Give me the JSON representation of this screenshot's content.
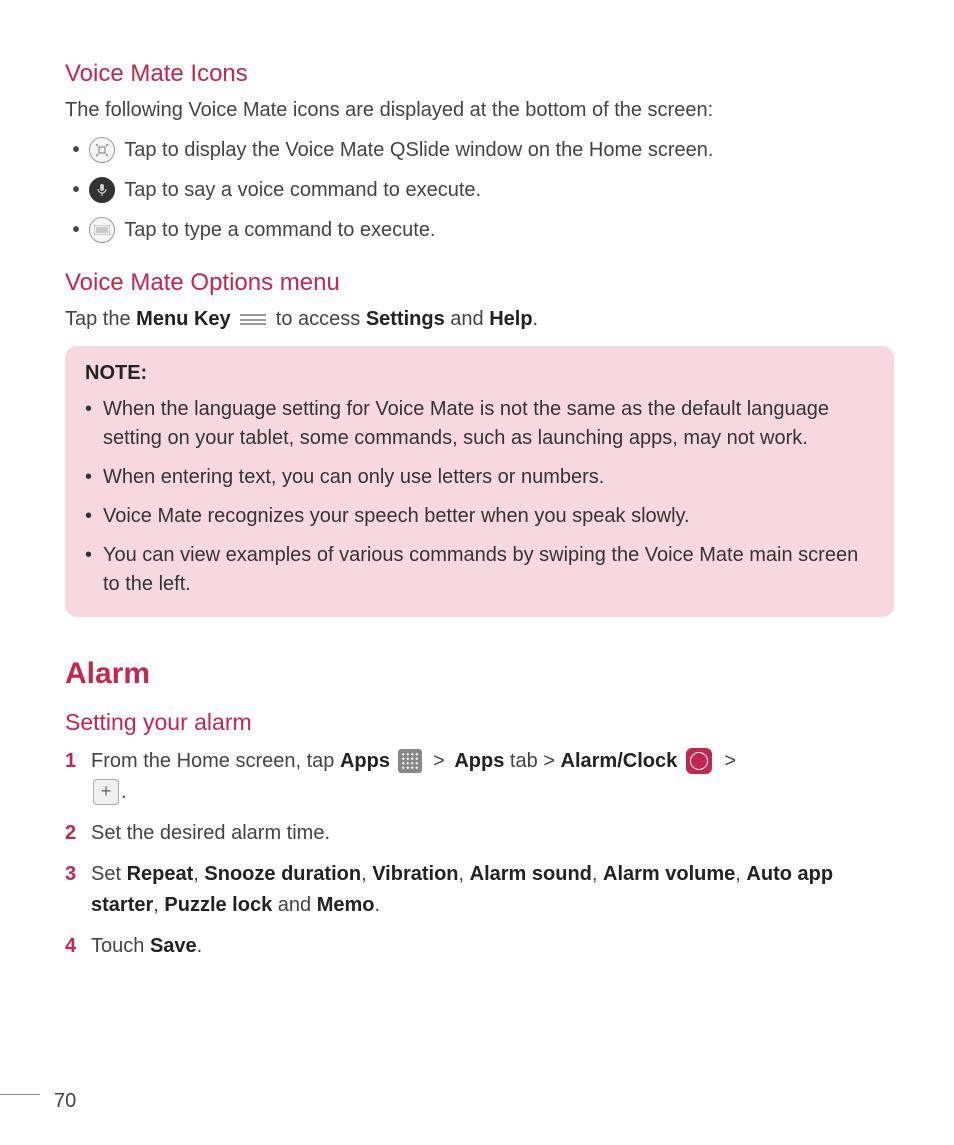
{
  "voiceMateIcons": {
    "heading": "Voice Mate Icons",
    "intro": "The following Voice Mate icons are displayed at the bottom of the screen:",
    "items": [
      {
        "iconName": "qslide-icon",
        "text": "Tap to display the Voice Mate QSlide window on the Home screen."
      },
      {
        "iconName": "mic-icon",
        "text": "Tap to say a voice command to execute."
      },
      {
        "iconName": "keyboard-icon",
        "text": "Tap to type a command to execute."
      }
    ]
  },
  "optionsMenu": {
    "heading": "Voice Mate Options menu",
    "pre": "Tap the ",
    "menuKey": "Menu Key",
    "mid": " to access ",
    "settings": "Settings",
    "and": " and ",
    "help": "Help",
    "period": "."
  },
  "note": {
    "title": "NOTE:",
    "items": [
      "When the language setting for Voice Mate is not the same as the default language setting on your tablet, some commands, such as launching apps, may not work.",
      "When entering text, you can only use letters or numbers.",
      "Voice Mate recognizes your speech better when you speak slowly.",
      "You can view examples of various commands by swiping the Voice Mate main screen to the left."
    ]
  },
  "alarm": {
    "heading": "Alarm",
    "subheading": "Setting your alarm",
    "steps": {
      "s1": {
        "num": "1",
        "pre": "From the Home screen, tap ",
        "apps": "Apps",
        "gt1": " > ",
        "appsTab": "Apps",
        "tab": " tab > ",
        "alarmClock": "Alarm/Clock",
        "gt2": " > "
      },
      "s2": {
        "num": "2",
        "text": "Set the desired alarm time."
      },
      "s3": {
        "num": "3",
        "pre": "Set ",
        "r": "Repeat",
        "c1": ", ",
        "sn": "Snooze duration",
        "c2": ", ",
        "vb": "Vibration",
        "c3": ", ",
        "as": "Alarm sound",
        "c4": ", ",
        "av": "Alarm volume",
        "c5": ", ",
        "aa": "Auto app starter",
        "c6": ", ",
        "pl": "Puzzle lock",
        "c7": " and ",
        "mm": "Memo",
        "c8": "."
      },
      "s4": {
        "num": "4",
        "pre": "Touch ",
        "save": "Save",
        "period": "."
      }
    }
  },
  "pageNumber": "70"
}
